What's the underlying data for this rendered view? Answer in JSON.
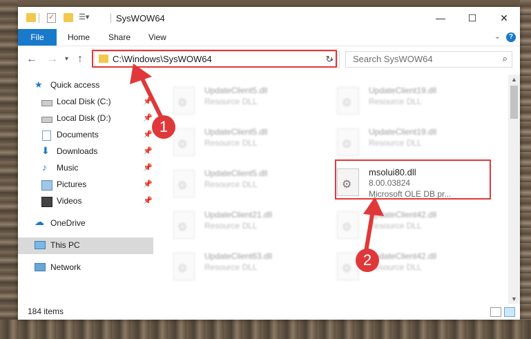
{
  "window": {
    "title": "SysWOW64",
    "controls": {
      "minimize": "—",
      "maximize": "☐",
      "close": "✕"
    }
  },
  "ribbon": {
    "file": "File",
    "tabs": [
      "Home",
      "Share",
      "View"
    ],
    "help": "?"
  },
  "navigation": {
    "address": "C:\\Windows\\SysWOW64",
    "search_placeholder": "Search SysWOW64"
  },
  "sidebar": {
    "items": [
      {
        "label": "Quick access",
        "icon": "star-icon",
        "pinned": false
      },
      {
        "label": "Local Disk (C:)",
        "icon": "drive-icon",
        "pinned": true
      },
      {
        "label": "Local Disk (D:)",
        "icon": "drive-icon",
        "pinned": true
      },
      {
        "label": "Documents",
        "icon": "documents-icon",
        "pinned": true
      },
      {
        "label": "Downloads",
        "icon": "download-icon",
        "pinned": true
      },
      {
        "label": "Music",
        "icon": "music-icon",
        "pinned": true
      },
      {
        "label": "Pictures",
        "icon": "pictures-icon",
        "pinned": true
      },
      {
        "label": "Videos",
        "icon": "video-icon",
        "pinned": true
      },
      {
        "label": "OneDrive",
        "icon": "cloud-icon",
        "pinned": false
      },
      {
        "label": "This PC",
        "icon": "computer-icon",
        "pinned": false,
        "selected": true
      },
      {
        "label": "Network",
        "icon": "network-icon",
        "pinned": false
      }
    ]
  },
  "files": [
    {
      "name": "UpdateClient5.dll",
      "type": "Resource DLL",
      "blurred": true
    },
    {
      "name": "UpdateClient19.dll",
      "type": "Resource DLL",
      "blurred": true
    },
    {
      "name": "UpdateClient5.dll",
      "type": "Resource DLL",
      "blurred": true
    },
    {
      "name": "UpdateClient19.dll",
      "type": "Resource DLL",
      "blurred": true
    },
    {
      "name": "UpdateClient5.dll",
      "type": "Resource DLL",
      "blurred": true
    },
    {
      "name": "msolui80.dll",
      "version": "8.00.03824",
      "type": "Microsoft OLE DB pr...",
      "blurred": false
    },
    {
      "name": "UpdateClient21.dll",
      "type": "Resource DLL",
      "blurred": true
    },
    {
      "name": "UpdateClient42.dll",
      "type": "Resource DLL",
      "blurred": true
    },
    {
      "name": "UpdateClient63.dll",
      "type": "Resource DLL",
      "blurred": true
    },
    {
      "name": "UpdateClient42.dll",
      "type": "Resource DLL",
      "blurred": true
    }
  ],
  "status": {
    "item_count": "184 items"
  },
  "annotations": {
    "step1": "1",
    "step2": "2",
    "color": "#e0383a"
  }
}
